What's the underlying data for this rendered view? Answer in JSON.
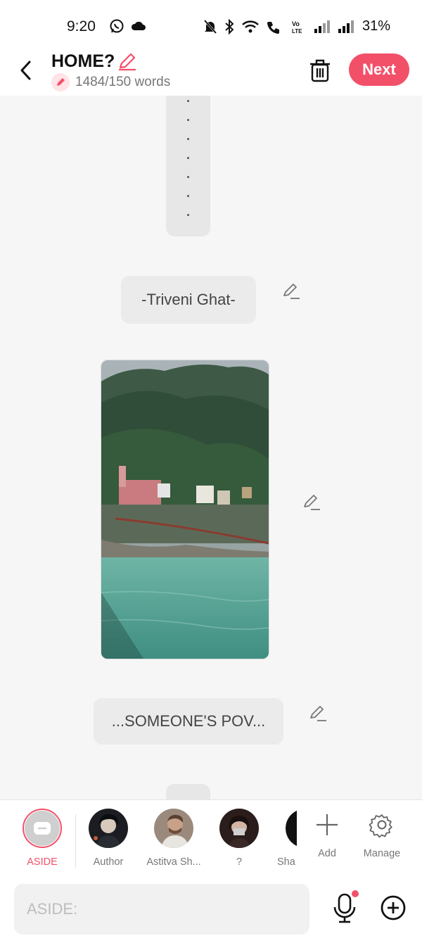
{
  "status_bar": {
    "time": "9:20",
    "battery": "31%",
    "icons": [
      "whatsapp-icon",
      "cloud-icon",
      "mute-icon",
      "bluetooth-icon",
      "wifi-icon",
      "wifi-call-icon",
      "volte-icon",
      "signal-icon",
      "signal-icon"
    ]
  },
  "header": {
    "title": "HOME?",
    "word_count": "1484/150 words",
    "next_label": "Next"
  },
  "story": {
    "bubble_scene": "-Triveni Ghat-",
    "bubble_pov": "...SOMEONE'S POV..."
  },
  "characters": [
    {
      "label": "ASIDE",
      "selected": true
    },
    {
      "label": "Author"
    },
    {
      "label": "Astitva Sh..."
    },
    {
      "label": "?"
    },
    {
      "label": "Sha"
    }
  ],
  "tools": {
    "add_label": "Add",
    "manage_label": "Manage"
  },
  "composer": {
    "placeholder": "ASIDE:"
  },
  "colors": {
    "accent": "#f25069",
    "background": "#f6f6f6",
    "bubble": "#ebebeb"
  }
}
